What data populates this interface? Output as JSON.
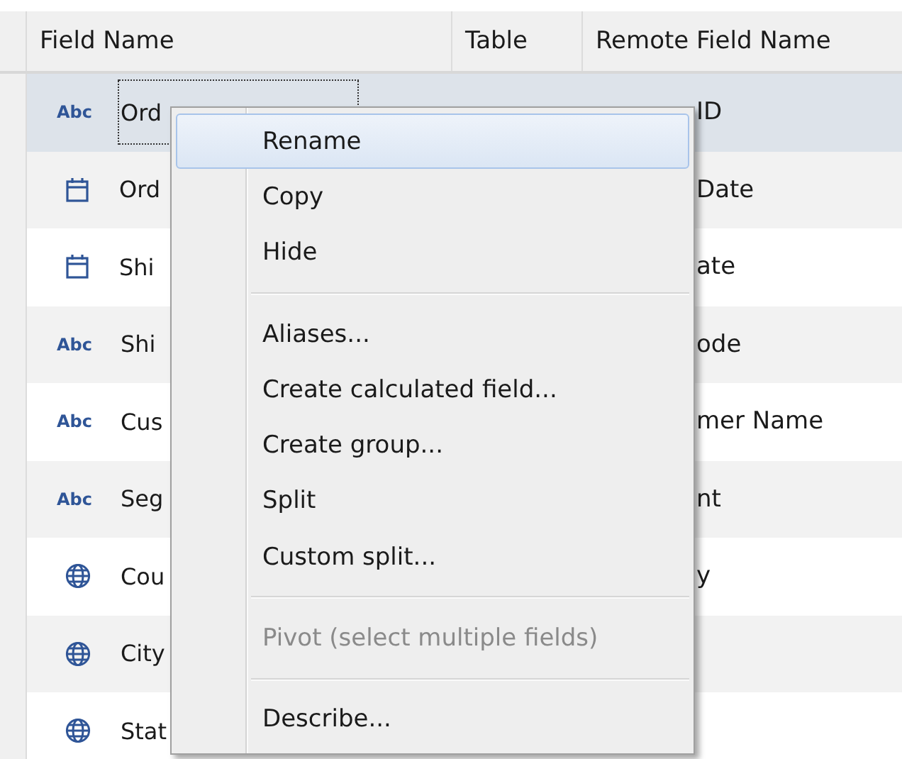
{
  "table": {
    "columns": [
      "Field Name",
      "Table",
      "Remote Field Name"
    ],
    "rows": [
      {
        "kind": "string",
        "type_label": "Abc",
        "field_name": "Ord",
        "remote_field_name": "ID",
        "selected": true
      },
      {
        "kind": "date",
        "field_name": "Ord",
        "remote_field_name": "Date",
        "selected": false
      },
      {
        "kind": "date",
        "field_name": "Shi",
        "remote_field_name": "ate",
        "selected": false
      },
      {
        "kind": "string",
        "type_label": "Abc",
        "field_name": "Shi",
        "remote_field_name": "ode",
        "selected": false
      },
      {
        "kind": "string",
        "type_label": "Abc",
        "field_name": "Cus",
        "remote_field_name": "mer Name",
        "selected": false
      },
      {
        "kind": "string",
        "type_label": "Abc",
        "field_name": "Seg",
        "remote_field_name": "nt",
        "selected": false
      },
      {
        "kind": "geo",
        "field_name": "Cou",
        "remote_field_name": "y",
        "selected": false
      },
      {
        "kind": "geo",
        "field_name": "City",
        "selected": false
      },
      {
        "kind": "geo",
        "field_name": "Stat",
        "selected": false
      }
    ]
  },
  "context_menu": {
    "items": [
      {
        "kind": "item",
        "label": "Rename",
        "highlighted": true,
        "disabled": false
      },
      {
        "kind": "item",
        "label": "Copy",
        "highlighted": false,
        "disabled": false
      },
      {
        "kind": "item",
        "label": "Hide",
        "highlighted": false,
        "disabled": false
      },
      {
        "kind": "separator"
      },
      {
        "kind": "item",
        "label": "Aliases...",
        "highlighted": false,
        "disabled": false
      },
      {
        "kind": "item",
        "label": "Create calculated field...",
        "highlighted": false,
        "disabled": false
      },
      {
        "kind": "item",
        "label": "Create group...",
        "highlighted": false,
        "disabled": false
      },
      {
        "kind": "item",
        "label": "Split",
        "highlighted": false,
        "disabled": false
      },
      {
        "kind": "item",
        "label": "Custom split...",
        "highlighted": false,
        "disabled": false
      },
      {
        "kind": "separator"
      },
      {
        "kind": "item",
        "label": "Pivot (select multiple fields)",
        "highlighted": false,
        "disabled": true
      },
      {
        "kind": "separator"
      },
      {
        "kind": "item",
        "label": "Describe...",
        "highlighted": false,
        "disabled": false
      }
    ]
  }
}
